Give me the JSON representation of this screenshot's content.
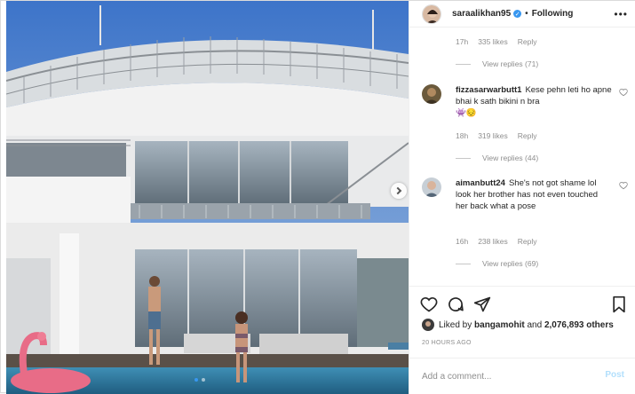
{
  "post": {
    "username": "saraalikhan95",
    "verified_icon": "verified-badge-icon",
    "separator": "•",
    "follow_state": "Following",
    "more_icon": "more-options-icon"
  },
  "top_comment_tail": {
    "time": "17h",
    "likes": "335 likes",
    "reply": "Reply",
    "view_replies": "View replies (71)"
  },
  "comments": [
    {
      "user": "fizzasarwarbutt1",
      "text": "Kese pehn leti ho apne bhai k sath bikini n bra",
      "emoji": "👾😔",
      "time": "18h",
      "likes": "319 likes",
      "reply": "Reply",
      "view_replies": "View replies (44)"
    },
    {
      "user": "aimanbutt24",
      "text": "She's not got shame lol look her brother has not even touched her back what a pose",
      "time": "16h",
      "likes": "238 likes",
      "reply": "Reply",
      "view_replies": "View replies (69)"
    }
  ],
  "actions": {
    "like_icon": "heart-icon",
    "comment_icon": "comment-icon",
    "share_icon": "paper-plane-icon",
    "save_icon": "bookmark-icon"
  },
  "likes": {
    "prefix": "Liked by",
    "user": "bangamohit",
    "middle": "and",
    "count": "2,076,893 others"
  },
  "timestamp": "20 HOURS AGO",
  "add_comment": {
    "placeholder": "Add a comment...",
    "post_label": "Post"
  },
  "carousel": {
    "total": 2,
    "current": 1
  },
  "colors": {
    "accent": "#3897f0",
    "muted": "#8e8e8e",
    "post_disabled": "#b2dffc"
  }
}
